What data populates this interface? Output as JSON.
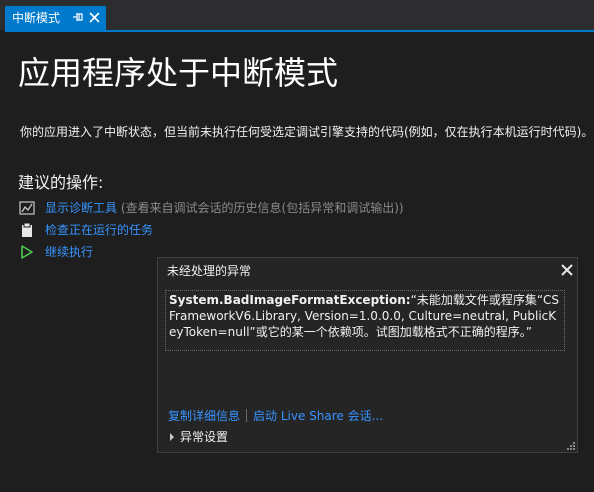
{
  "tab": {
    "title": "中断模式",
    "icons": {
      "pin": "pin-icon",
      "close": "close-icon"
    }
  },
  "main": {
    "title": "应用程序处于中断模式",
    "description": "你的应用进入了中断状态，但当前未执行任何受选定调试引擎支持的代码(例如，仅在执行本机运行时代码)。",
    "actions_heading": "建议的操作:",
    "actions": [
      {
        "icon": "diagnostic-chart-icon",
        "label": "显示诊断工具",
        "hint": "(查看来自调试会话的历史信息(包括异常和调试输出))"
      },
      {
        "icon": "clipboard-task-icon",
        "label": "检查正在运行的任务",
        "hint": ""
      },
      {
        "icon": "play-icon",
        "label": "继续执行",
        "hint": ""
      }
    ]
  },
  "exception_popup": {
    "title": "未经处理的异常",
    "exception_type": "System.BadImageFormatException:",
    "message": "“未能加载文件或程序集“CSFrameworkV6.Library, Version=1.0.0.0, Culture=neutral, PublicKeyToken=null”或它的某一个依赖项。试图加载格式不正确的程序。”",
    "links": {
      "copy_details": "复制详细信息",
      "live_share": "启动 Live Share 会话..."
    },
    "settings_label": "异常设置"
  },
  "colors": {
    "background": "#1e1e1e",
    "tab_accent": "#007acc",
    "link": "#3794ff",
    "hint": "#8a8a8a",
    "popup_background": "#252526",
    "play_green": "#4ec94e"
  }
}
